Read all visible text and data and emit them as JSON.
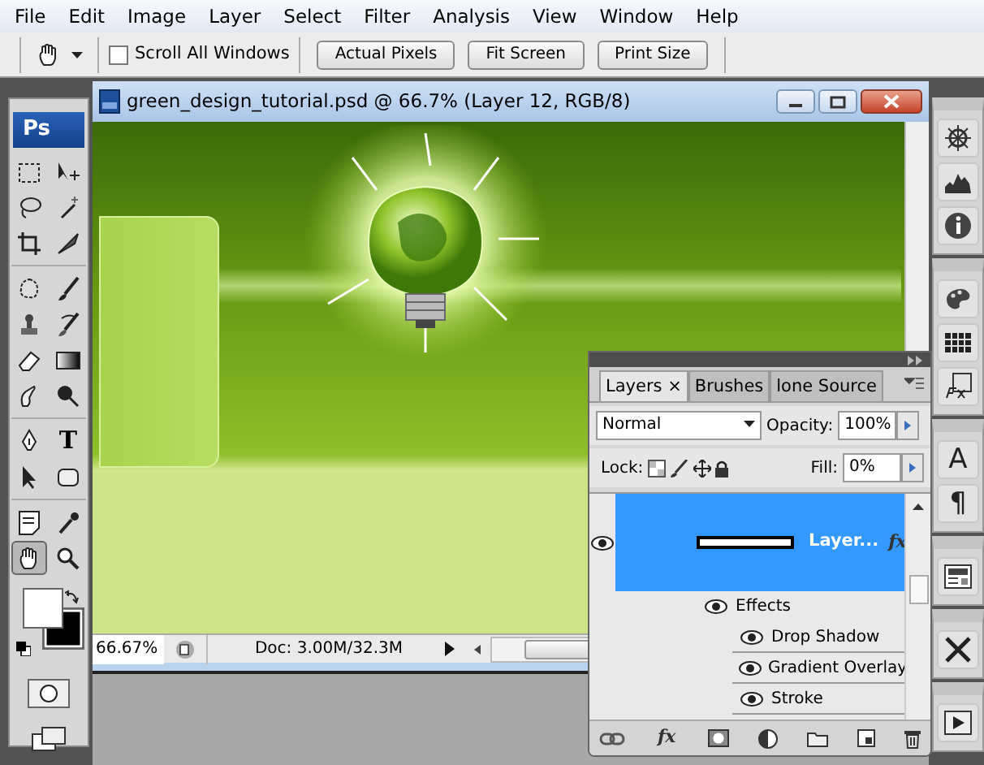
{
  "menu_bar": [
    "File",
    "Edit",
    "Image",
    "Layer",
    "Select",
    "Filter",
    "Analysis",
    "View",
    "Window",
    "Help"
  ],
  "options_bar": {
    "scroll_all_windows": {
      "label": "Scroll All Windows",
      "checked": false
    },
    "buttons": [
      "Actual Pixels",
      "Fit Screen",
      "Print Size"
    ]
  },
  "toolbox": {
    "logo": "Ps",
    "tools": [
      {
        "selected": false
      },
      {
        "selected": false
      },
      {
        "selected": false
      },
      {
        "selected": false
      },
      {
        "selected": false
      },
      {
        "selected": false
      },
      {
        "selected": false
      },
      {
        "selected": false
      },
      {
        "selected": false
      },
      {
        "selected": false
      },
      {
        "selected": false
      },
      {
        "selected": false
      },
      {
        "selected": false
      },
      {
        "selected": false
      },
      {
        "selected": false
      },
      {
        "selected": false,
        "glyph": "T"
      },
      {
        "selected": false
      },
      {
        "selected": false
      },
      {
        "selected": false
      },
      {
        "selected": false
      },
      {
        "selected": true
      },
      {
        "selected": false
      }
    ]
  },
  "document": {
    "title": "green_design_tutorial.psd @ 66.7% (Layer 12, RGB/8)",
    "zoom": "66.67%",
    "doc_info": "Doc: 3.00M/32.3M"
  },
  "layers_panel": {
    "tabs": [
      {
        "label": "Layers",
        "close": "×",
        "selected": true
      },
      {
        "label": "Brushes",
        "selected": false
      },
      {
        "label": "lone Source",
        "selected": false
      }
    ],
    "blend_mode": "Normal",
    "opacity_label": "Opacity:",
    "opacity": "100%",
    "lock_label": "Lock:",
    "fill_label": "Fill:",
    "fill": "0%",
    "layers": [
      {
        "name": "Layer...",
        "fx": "fx",
        "selected": true,
        "visible": true,
        "children": [
          {
            "name": "Effects",
            "visible": true,
            "children": [
              {
                "name": "Drop Shadow",
                "visible": true
              },
              {
                "name": "Gradient Overlay",
                "visible": true
              },
              {
                "name": "Stroke",
                "visible": true
              }
            ]
          }
        ]
      }
    ],
    "footer_fx": "fx"
  },
  "right_dock": [
    [
      {
        "kind": "icon"
      },
      {
        "kind": "icon"
      },
      {
        "kind": "icon"
      }
    ],
    [
      {
        "kind": "icon"
      },
      {
        "kind": "icon"
      },
      {
        "kind": "icon"
      }
    ],
    [
      {
        "kind": "glyph",
        "text": "A"
      },
      {
        "kind": "glyph",
        "text": "¶"
      }
    ],
    [
      {
        "kind": "icon"
      }
    ],
    [
      {
        "kind": "icon"
      }
    ],
    [
      {
        "kind": "icon"
      }
    ]
  ]
}
